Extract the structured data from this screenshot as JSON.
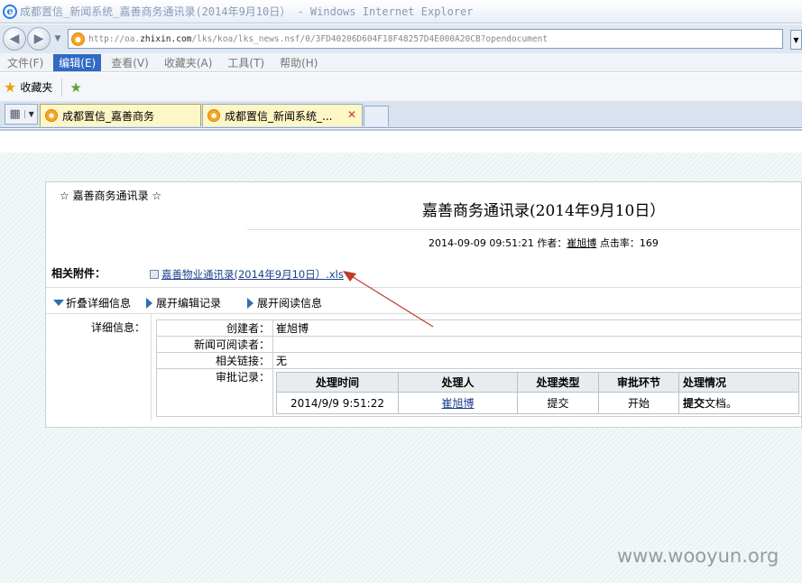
{
  "window": {
    "title": "成都置信_新闻系统_嘉善商务通讯录(2014年9月10日） - Windows Internet Explorer"
  },
  "address": {
    "url_prefix": "http://oa.",
    "url_domain": "zhixin.com",
    "url_path": "/lks/koa/lks_news.nsf/0/3FD40206D604F18F48257D4E000A20CB?opendocument"
  },
  "menu": [
    {
      "label": "文件(F)",
      "active": false
    },
    {
      "label": "编辑(E)",
      "active": true
    },
    {
      "label": "查看(V)",
      "active": false
    },
    {
      "label": "收藏夹(A)",
      "active": false
    },
    {
      "label": "工具(T)",
      "active": false
    },
    {
      "label": "帮助(H)",
      "active": false
    }
  ],
  "favorites": {
    "label": "收藏夹"
  },
  "tabs": [
    {
      "label": "成都置信_嘉善商务"
    },
    {
      "label": "成都置信_新闻系统_..."
    }
  ],
  "doc": {
    "kicker": "☆ 嘉善商务通讯录 ☆",
    "title": "嘉善商务通讯录(2014年9月10日）",
    "date": "2014-09-09 09:51:21",
    "author_label": "作者：",
    "author": "崔旭博",
    "hits_label": "点击率：",
    "hits": "169",
    "attachments_label": "相关附件：",
    "attachment": "嘉善物业通讯录(2014年9月10日）.xls",
    "actions": {
      "collapse": "折叠详细信息",
      "edit_log": "展开编辑记录",
      "read_info": "展开阅读信息"
    },
    "detail_label": "详细信息：",
    "info": {
      "creator_label": "创建者：",
      "creator": "崔旭博",
      "readers_label": "新闻可阅读者：",
      "readers": "",
      "links_label": "相关链接：",
      "links": "无",
      "approval_label": "审批记录："
    },
    "approval": {
      "headers": [
        "处理时间",
        "处理人",
        "处理类型",
        "审批环节",
        "处理情况"
      ],
      "row": {
        "time": "2014/9/9 9:51:22",
        "person": "崔旭博",
        "type": "提交",
        "step": "开始",
        "status_bold": "提交",
        "status_rest": "文档。"
      }
    }
  },
  "watermark": "www.wooyun.org",
  "colors": {
    "menu_active": "#316ac5",
    "link": "#1a3f8a",
    "arrow": "#c0392b",
    "triangle": "#2d6eb5"
  }
}
